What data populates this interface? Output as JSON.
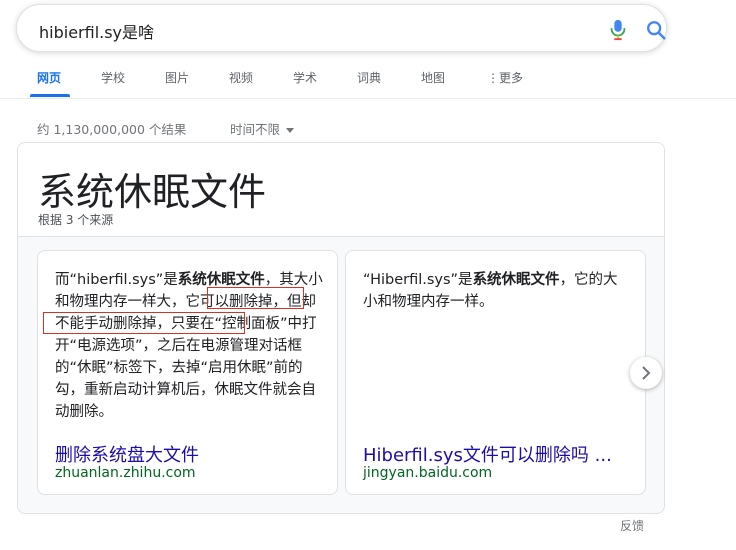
{
  "search": {
    "query": "hibierfil.sy是啥"
  },
  "tabs": [
    {
      "label": "网页",
      "active": true
    },
    {
      "label": "学校"
    },
    {
      "label": "图片"
    },
    {
      "label": "视频"
    },
    {
      "label": "学术"
    },
    {
      "label": "词典"
    },
    {
      "label": "地图"
    },
    {
      "label": "更多"
    }
  ],
  "results": {
    "stats": "约 1,130,000,000 个结果",
    "time_filter": "时间不限"
  },
  "snippet": {
    "title": "系统休眠文件",
    "source_count": "根据 3 个来源",
    "cards": [
      {
        "text_pre": "而“hiberfil.sys”是",
        "text_bold": "系统休眠文件",
        "text_post": "，其大小和物理内存一样大，它可以删除掉，但却不能手动删除掉，只要在“控制面板”中打开“电源选项”，之后在电源管理对话框的“休眠”标签下，去掉“启用休眠”前的勾，重新启动计算机后，休眠文件就会自动删除。",
        "link": "删除系统盘大文件",
        "cite": "zhuanlan.zhihu.com"
      },
      {
        "text_pre": "“Hiberfil.sys”是",
        "text_bold": "系统休眠文件",
        "text_post": "，它的大小和物理内存一样。",
        "link": "Hiberfil.sys文件可以删除吗 ...",
        "cite": "jingyan.baidu.com"
      }
    ]
  },
  "footer": {
    "feedback": "反馈"
  },
  "colors": {
    "accent": "#1a73e8",
    "link": "#1a0dab",
    "cite": "#006621",
    "highlight_box": "#d93025"
  }
}
